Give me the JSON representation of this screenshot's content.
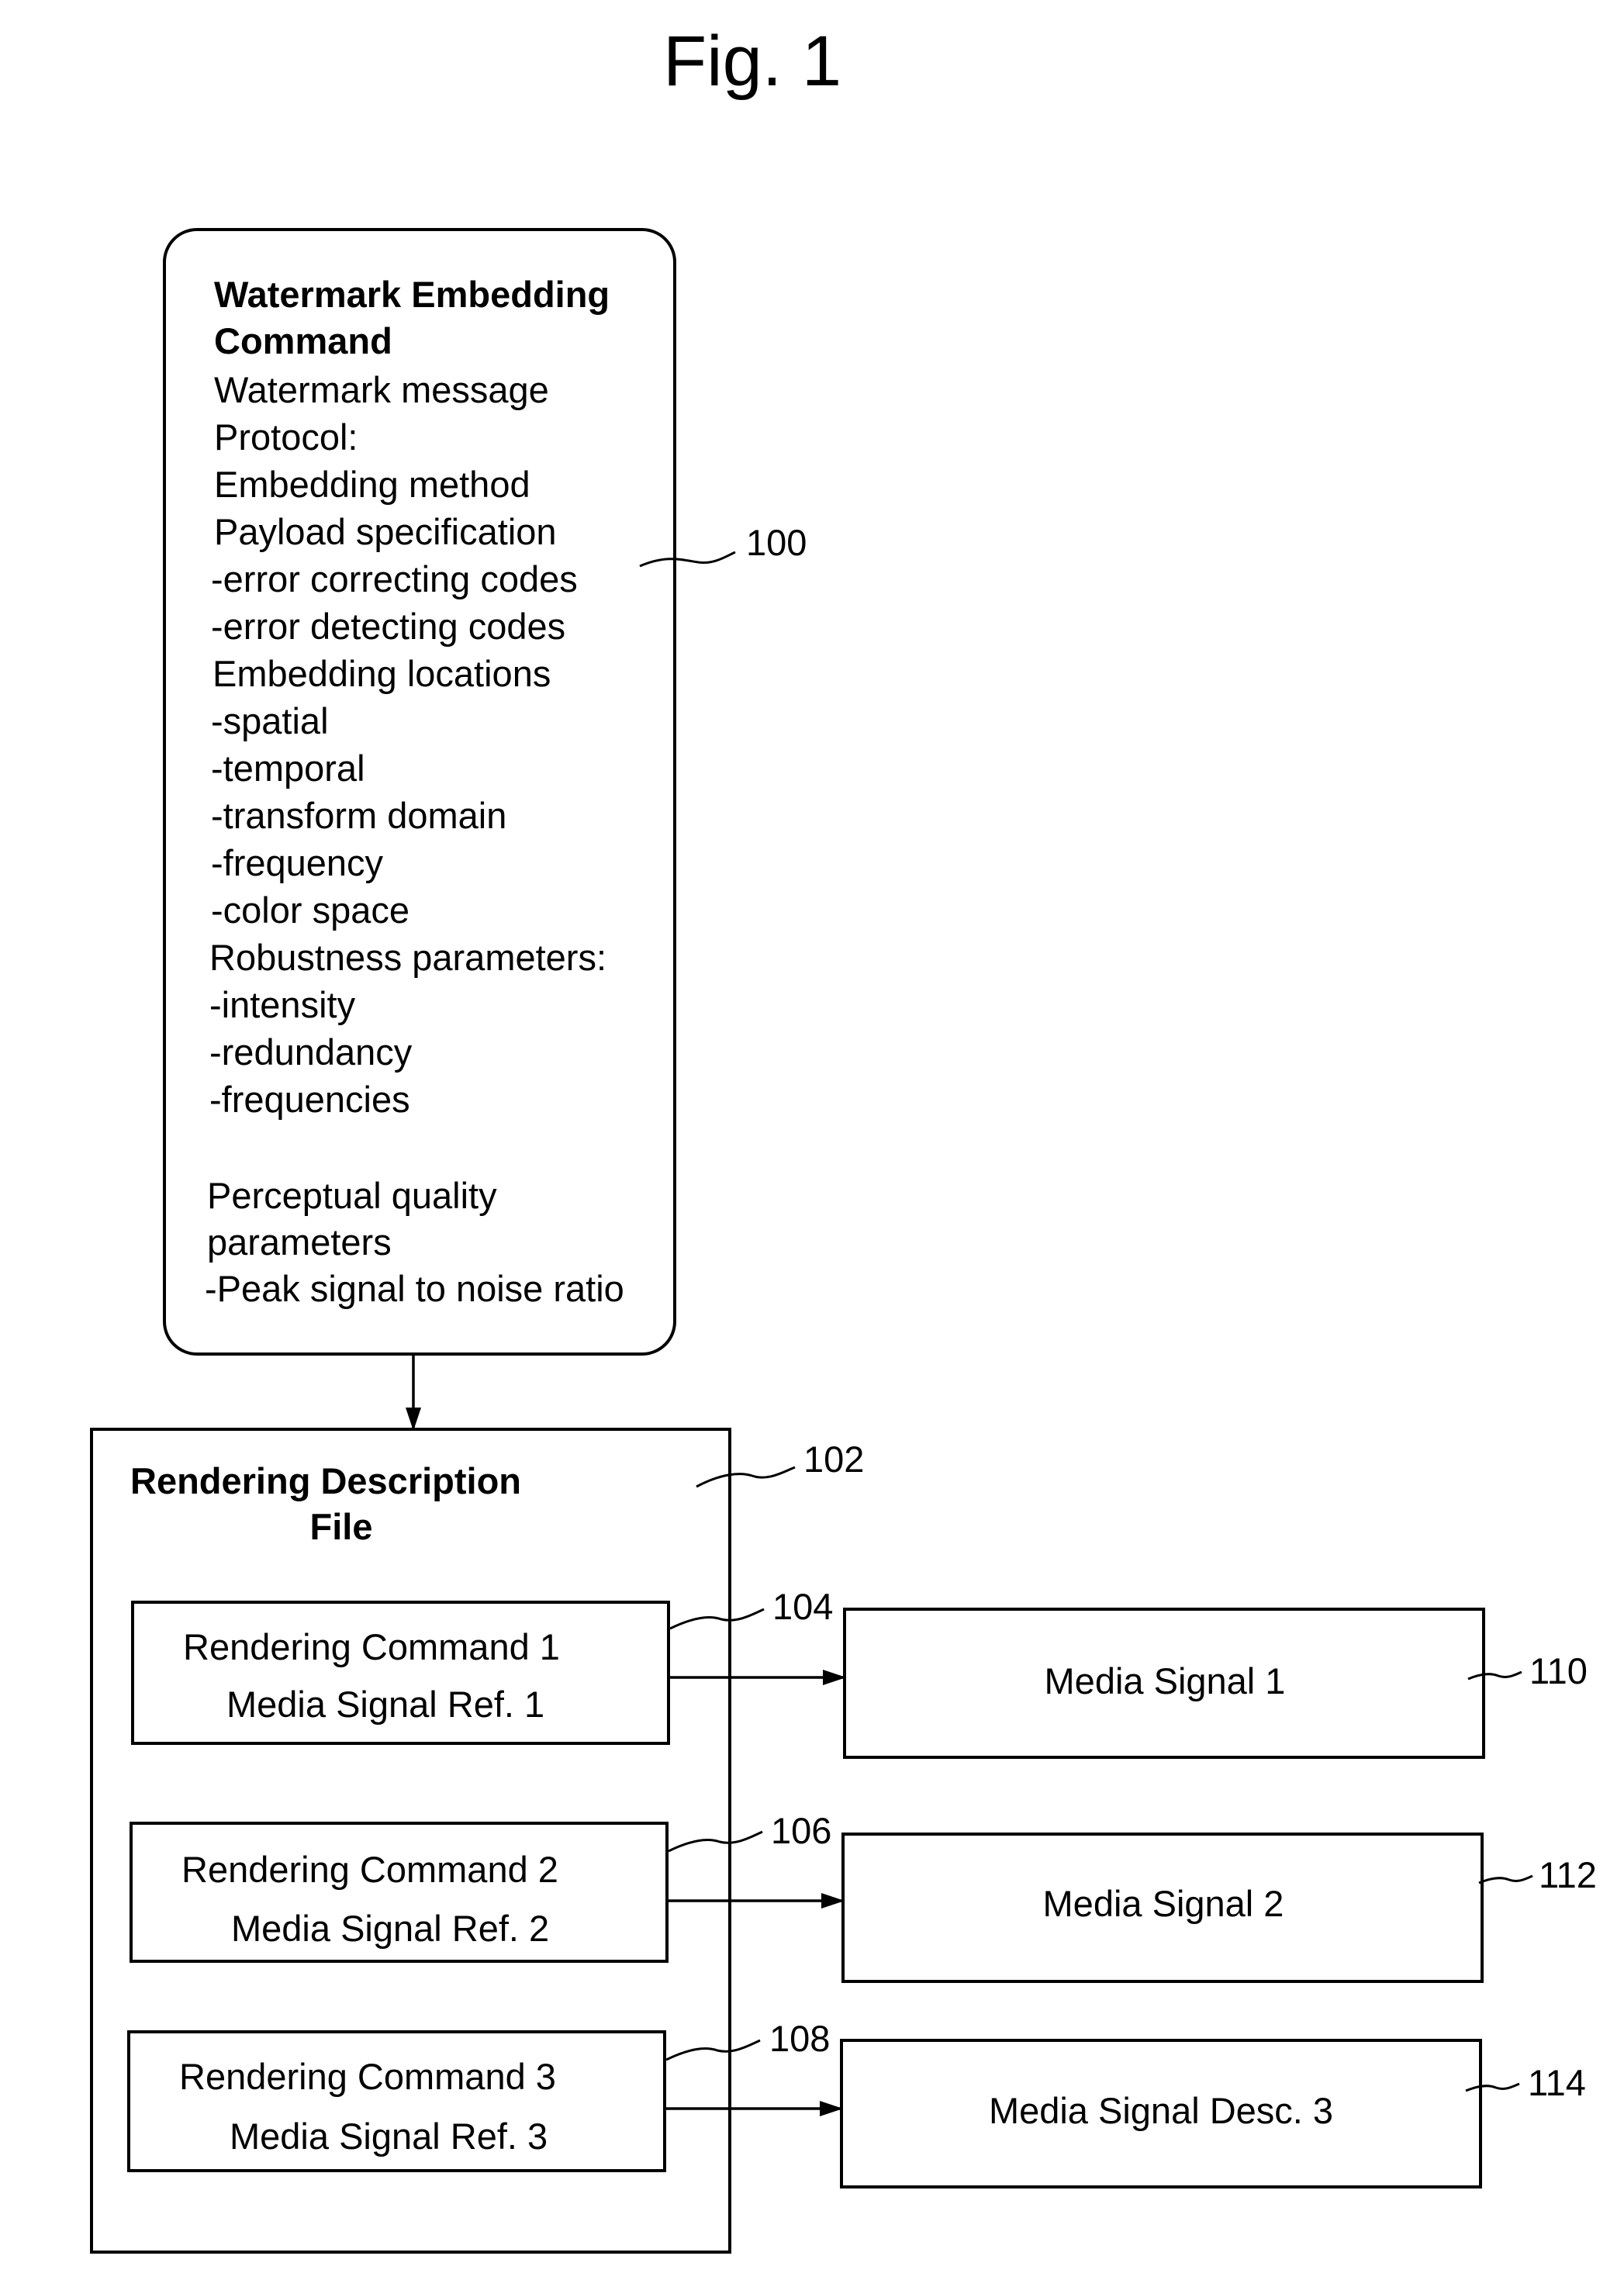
{
  "figure": {
    "title": "Fig. 1"
  },
  "watermark_box": {
    "ref": "100",
    "heading": [
      "Watermark Embedding",
      "Command"
    ],
    "lines": [
      "Watermark message",
      "Protocol:",
      "Embedding method",
      "Payload specification",
      "-error correcting codes",
      "-error detecting codes",
      "Embedding locations",
      "-spatial",
      "-temporal",
      "-transform domain",
      "-frequency",
      "-color space",
      "Robustness parameters:",
      "-intensity",
      "-redundancy",
      "-frequencies"
    ],
    "lines2": [
      "Perceptual quality",
      "parameters",
      "-Peak signal to noise ratio"
    ]
  },
  "rendering_file": {
    "ref": "102",
    "heading": [
      "Rendering Description",
      "File"
    ],
    "commands": [
      {
        "ref": "104",
        "command": "Rendering Command 1",
        "signal_ref": "Media Signal Ref. 1"
      },
      {
        "ref": "106",
        "command": "Rendering Command 2",
        "signal_ref": "Media Signal Ref. 2"
      },
      {
        "ref": "108",
        "command": "Rendering Command 3",
        "signal_ref": "Media Signal Ref. 3"
      }
    ]
  },
  "media_signals": [
    {
      "ref": "110",
      "label": "Media Signal 1"
    },
    {
      "ref": "112",
      "label": "Media Signal 2"
    },
    {
      "ref": "114",
      "label": "Media Signal Desc. 3"
    }
  ]
}
